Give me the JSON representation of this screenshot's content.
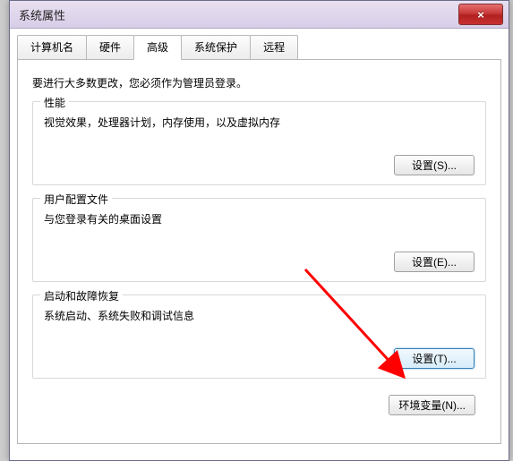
{
  "title": "系统属性",
  "tabs": {
    "computer_name": "计算机名",
    "hardware": "硬件",
    "advanced": "高级",
    "system_protection": "系统保护",
    "remote": "远程"
  },
  "intro": "要进行大多数更改，您必须作为管理员登录。",
  "perf": {
    "title": "性能",
    "desc": "视觉效果，处理器计划，内存使用，以及虚拟内存",
    "btn": "设置(S)..."
  },
  "profile": {
    "title": "用户配置文件",
    "desc": "与您登录有关的桌面设置",
    "btn": "设置(E)..."
  },
  "startup": {
    "title": "启动和故障恢复",
    "desc": "系统启动、系统失败和调试信息",
    "btn": "设置(T)..."
  },
  "env_btn": "环境变量(N)...",
  "close_glyph": "×"
}
